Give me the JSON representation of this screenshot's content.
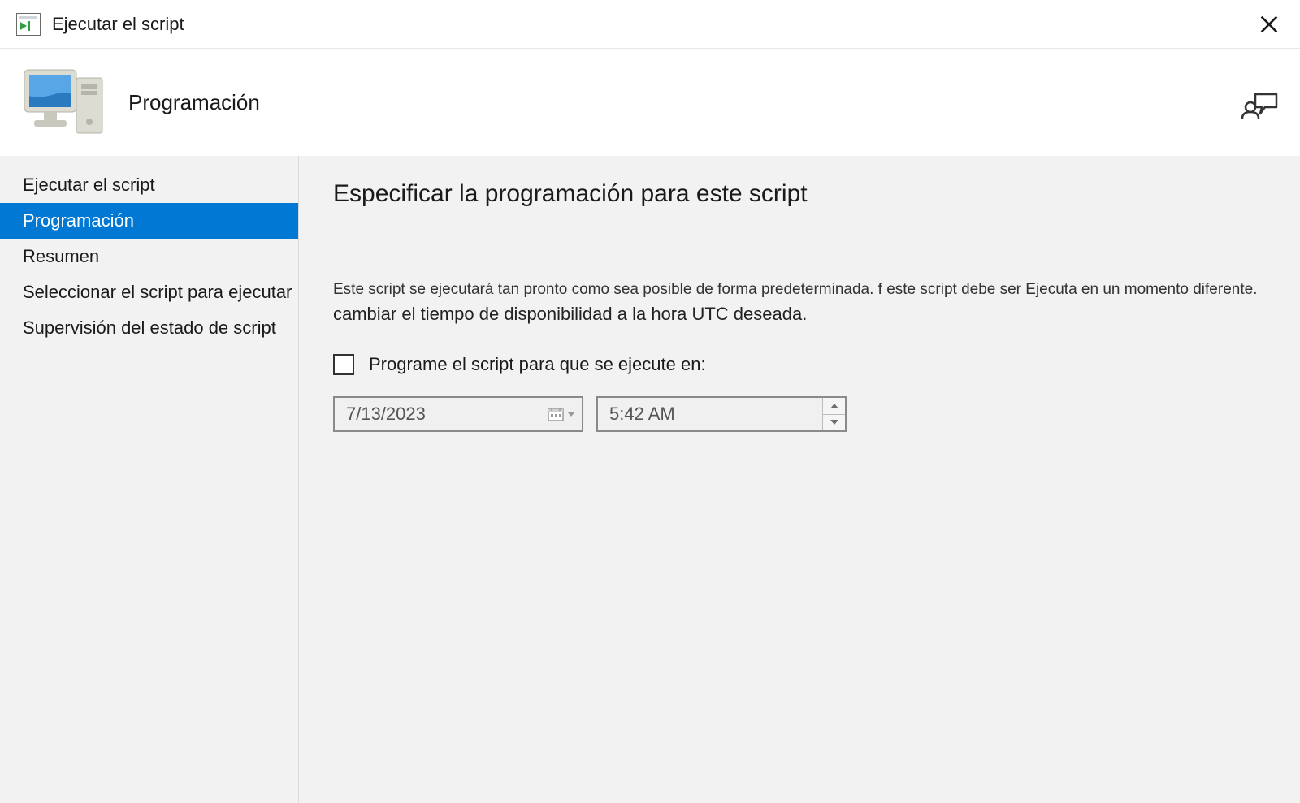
{
  "window": {
    "title": "Ejecutar el script"
  },
  "header": {
    "page_title": "Programación"
  },
  "sidebar": {
    "items": [
      {
        "label": "Ejecutar el script",
        "active": false
      },
      {
        "label": "Programación",
        "active": true
      },
      {
        "label": "Resumen",
        "active": false
      },
      {
        "label": "Seleccionar el script para ejecutar",
        "active": false
      },
      {
        "label": "Supervisión del estado de script",
        "active": false
      }
    ]
  },
  "content": {
    "heading": "Especificar la programación para este script",
    "description_line1": "Este script se ejecutará tan pronto como sea posible de forma predeterminada. f este script debe ser Ejecuta en un momento diferente.",
    "description_line2": "cambiar el tiempo de disponibilidad a la hora UTC deseada.",
    "checkbox_label": "Programe el script para que se ejecute en:",
    "checkbox_checked": false,
    "date_value": "7/13/2023",
    "time_value": "5:42 AM"
  },
  "colors": {
    "accent": "#0078d4"
  }
}
